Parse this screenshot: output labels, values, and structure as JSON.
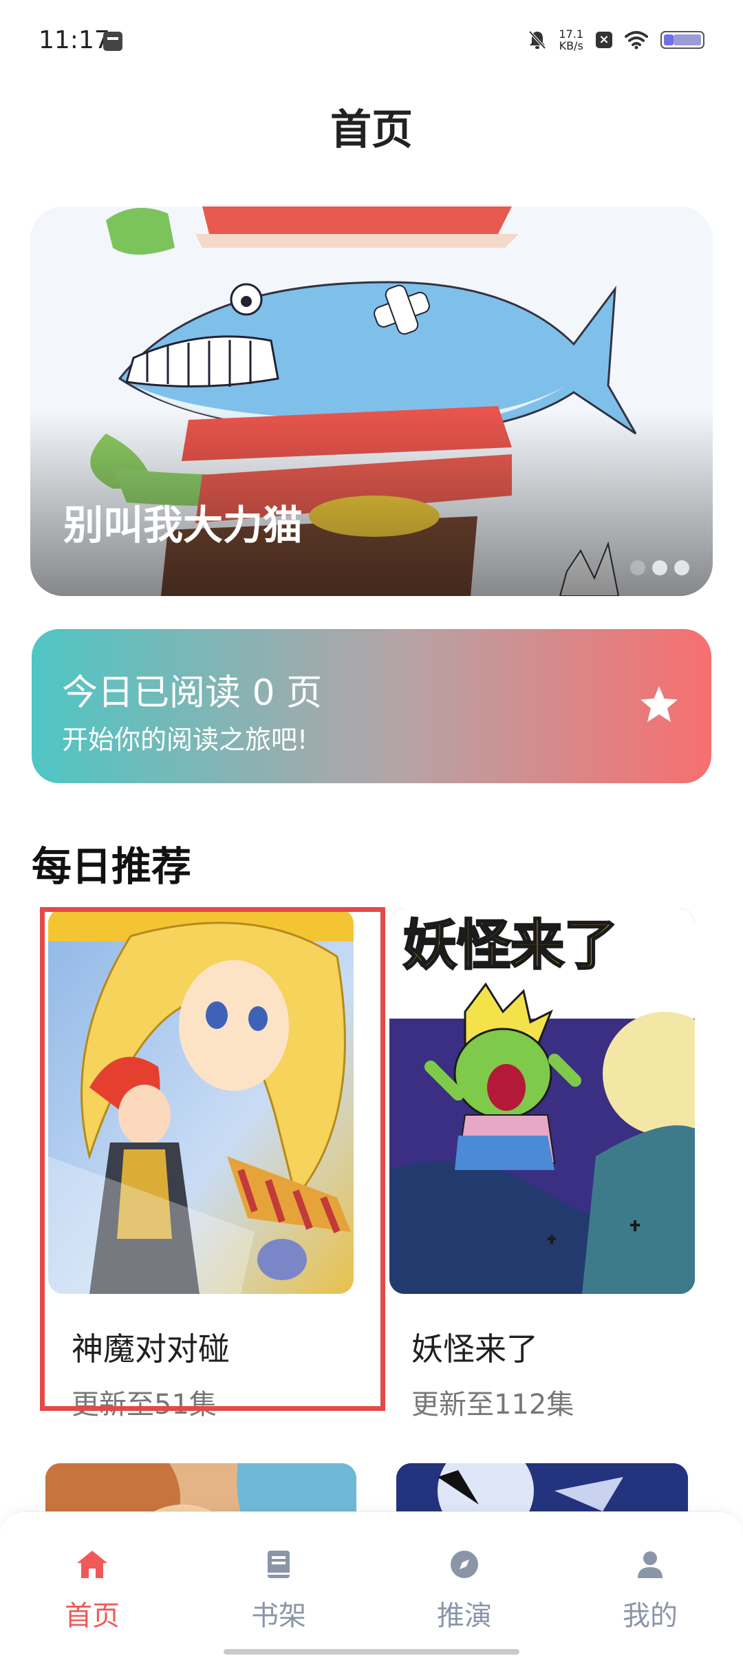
{
  "status_bar": {
    "time": "11:17",
    "net_speed": "17.1",
    "net_unit": "KB/s"
  },
  "header": {
    "title": "首页"
  },
  "banner": {
    "title": "别叫我大力猫",
    "page_count": 3,
    "active_page": 2
  },
  "reading": {
    "title": "今日已阅读 0 页",
    "subtitle": "开始你的阅读之旅吧!",
    "icon": "star-icon"
  },
  "daily": {
    "section_title": "每日推荐",
    "items": [
      {
        "name": "神魔对对碰",
        "meta": "更新至51集",
        "selected": true
      },
      {
        "name": "妖怪来了",
        "meta": "更新至112集",
        "cover_text": "妖怪来了"
      }
    ],
    "cover_text_1": "神魔对对碰"
  },
  "nav": {
    "items": [
      {
        "label": "首页",
        "icon": "home-icon",
        "active": true
      },
      {
        "label": "书架",
        "icon": "book-icon",
        "active": false
      },
      {
        "label": "推演",
        "icon": "compass-icon",
        "active": false
      },
      {
        "label": "我的",
        "icon": "user-icon",
        "active": false
      }
    ],
    "active_color": "#ef5a58",
    "inactive_color": "#8a96a8"
  },
  "colors": {
    "card_gradient_start": "#4ec6c4",
    "card_gradient_end": "#f76f6f",
    "highlight": "#e24a4a"
  }
}
